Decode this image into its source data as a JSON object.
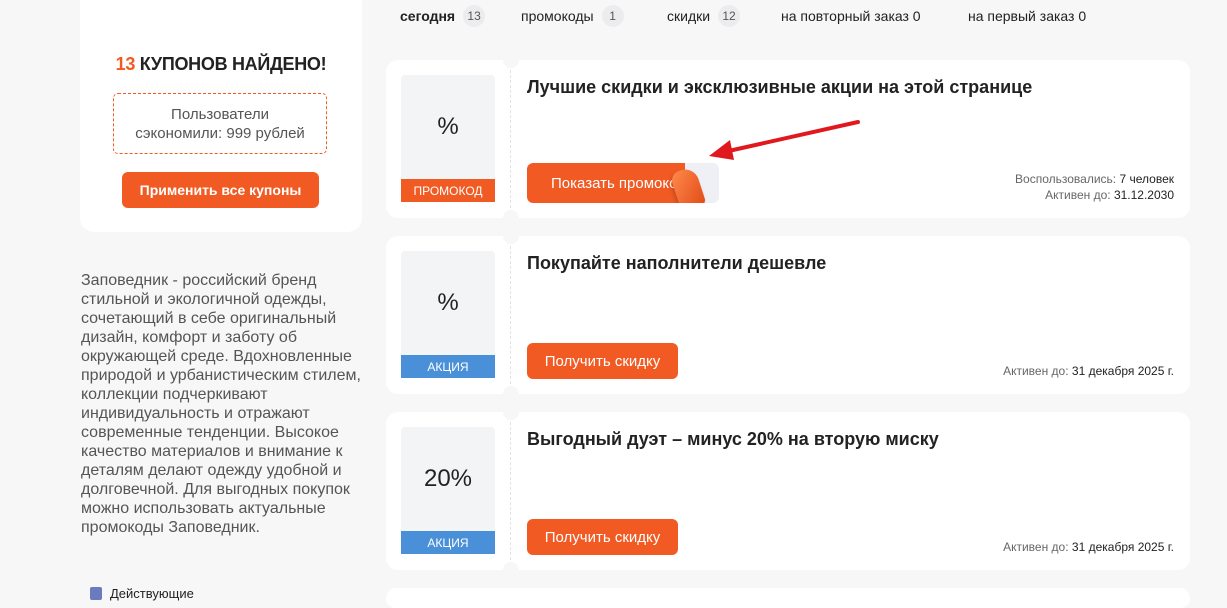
{
  "summary": {
    "found_count": "13",
    "found_text": "КУПОНОВ НАЙДЕНО!",
    "saved_line1": "Пользователи",
    "saved_line2": "сэкономили: 999 рублей",
    "apply_button": "Применить все купоны"
  },
  "store_description": "Заповедник - российский бренд стильной и экологичной одежды, сочетающий в себе оригинальный дизайн, комфорт и заботу об окружающей среде. Вдохновленные природой и урбанистическим стилем, коллекции подчеркивают индивидуальность и отражают современные тенденции. Высокое качество материалов и внимание к деталям делают одежду удобной и долговечной. Для выгодных покупок можно использовать актуальные промокоды Заповедник.",
  "filters_footer_label": "Действующие",
  "tabs": [
    {
      "label": "сегодня",
      "count": "13",
      "active": true
    },
    {
      "label": "промокоды",
      "count": "1"
    },
    {
      "label": "скидки",
      "count": "12"
    },
    {
      "label": "на повторный заказ 0"
    },
    {
      "label": "на первый заказ 0"
    }
  ],
  "coupons": [
    {
      "discount": "%",
      "type": "ПРОМОКОД",
      "title": "Лучшие скидки и эксклюзивные акции на этой странице",
      "button": "Показать промокод",
      "used_label": "Воспользовались:",
      "used_value": "7 человек",
      "active_label": "Активен до:",
      "active_value": "31.12.2030"
    },
    {
      "discount": "%",
      "type": "АКЦИЯ",
      "title": "Покупайте наполнители дешевле",
      "button": "Получить скидку",
      "active_label": "Активен до:",
      "active_value": "31 декабря 2025 г."
    },
    {
      "discount": "20%",
      "type": "АКЦИЯ",
      "title": "Выгодный дуэт – минус 20% на вторую миску",
      "button": "Получить скидку",
      "active_label": "Активен до:",
      "active_value": "31 декабря 2025 г."
    }
  ],
  "colors": {
    "accent": "#f15a22",
    "deal_label": "#4a90d9",
    "arrow": "#e0191e"
  }
}
